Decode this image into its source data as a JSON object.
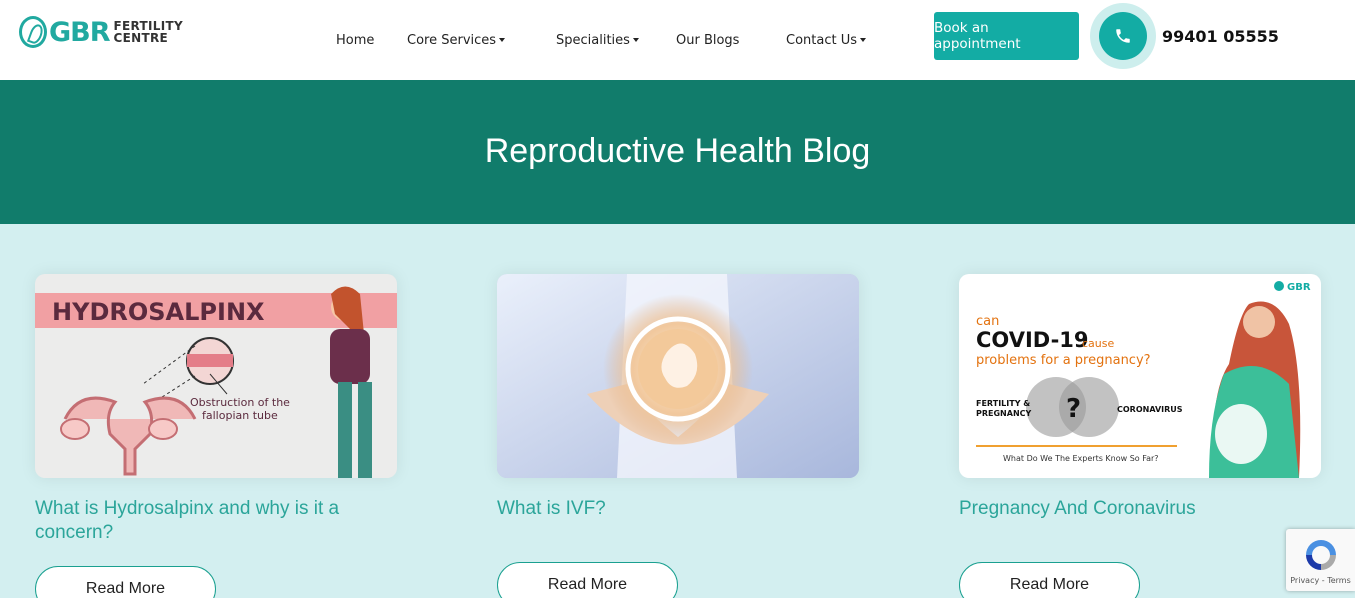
{
  "logo": {
    "gbr": "GBR",
    "line1": "FERTILITY",
    "line2": "CENTRE"
  },
  "nav": {
    "home": "Home",
    "core_services": "Core Services",
    "specialities": "Specialities",
    "our_blogs": "Our Blogs",
    "contact_us": "Contact Us"
  },
  "cta": {
    "book": "Book an appointment",
    "phone": "99401 05555"
  },
  "banner": {
    "title": "Reproductive Health Blog"
  },
  "cards": [
    {
      "title": "What is Hydrosalpinx and why is it a concern?",
      "read_more": "Read More",
      "image": {
        "heading": "HYDROSALPINX",
        "caption1": "Obstruction of the",
        "caption2": "fallopian tube"
      }
    },
    {
      "title": "What is IVF?",
      "read_more": "Read More"
    },
    {
      "title": "Pregnancy And Coronavirus",
      "read_more": "Read More",
      "image": {
        "brand": "GBR",
        "l1": "can",
        "l2": "COVID-19",
        "l3": "cause",
        "l4": "problems for a pregnancy?",
        "left1": "FERTILITY &",
        "left2": "PREGNANCY",
        "right": "CORONAVIRUS",
        "q": "?",
        "footer": "What Do We The Experts Know So Far?"
      }
    }
  ],
  "recaptcha": {
    "text": "Privacy - Terms"
  },
  "colors": {
    "accent": "#13aca4",
    "banner": "#117c6b",
    "page_bg": "#d3eff0",
    "title_teal": "#2ba59a"
  },
  "icons": [
    "phone-icon",
    "caret-down-icon",
    "recaptcha-icon"
  ]
}
